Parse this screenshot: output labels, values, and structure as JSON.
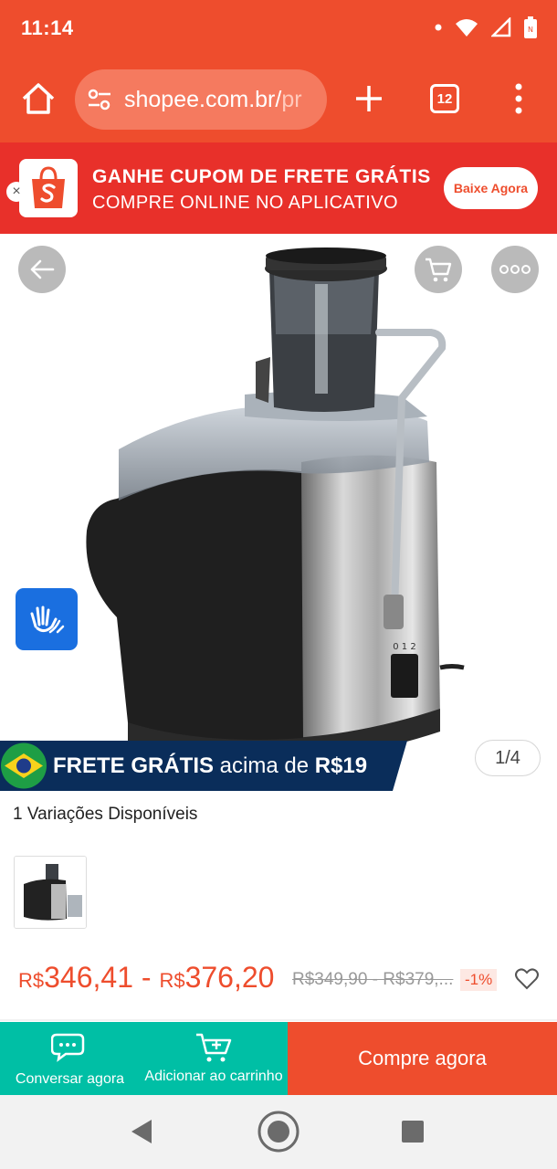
{
  "status": {
    "time": "11:14"
  },
  "browser": {
    "url_host": "shopee.com.br/",
    "url_rest": "pr",
    "tab_count": "12"
  },
  "banner": {
    "title": "GANHE CUPOM DE FRETE GRÁTIS",
    "subtitle": "COMPRE ONLINE NO APLICATIVO",
    "cta": "Baixe Agora",
    "close": "×"
  },
  "product": {
    "shipping_strong": "FRETE GRÁTIS",
    "shipping_mid": " acima de ",
    "shipping_amount": "R$19",
    "image_counter": "1/4",
    "variations": "1 Variações Disponíveis",
    "currency": "R$",
    "price_min": "346,41",
    "price_sep": " - ",
    "price_max": "376,20",
    "old_price": "R$349,90 - R$379,...",
    "discount": "-1%"
  },
  "actions": {
    "chat": "Conversar agora",
    "add_cart": "Adicionar ao carrinho",
    "buy": "Compre agora"
  },
  "colors": {
    "brand": "#ee4d2d",
    "teal": "#00bfa5",
    "a11y": "#1a6fe0"
  }
}
